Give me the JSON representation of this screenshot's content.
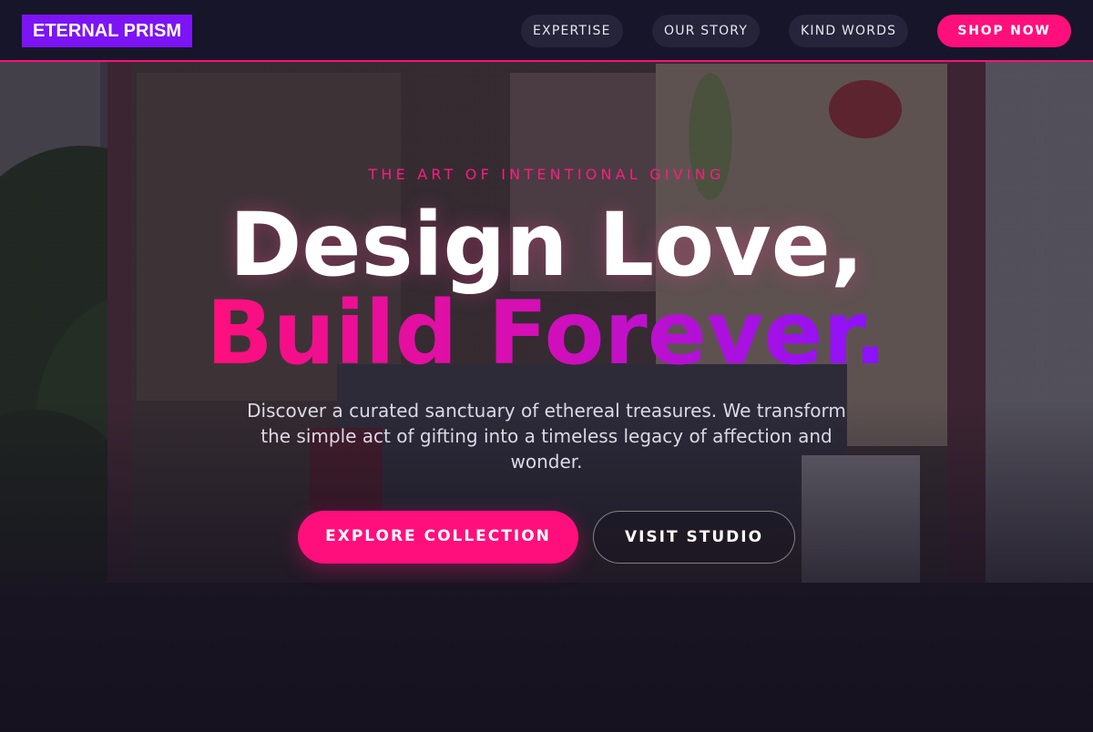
{
  "nav": {
    "logo": "ETERNAL PRISM",
    "links": [
      "EXPERTISE",
      "OUR STORY",
      "KIND WORDS"
    ],
    "cta": "SHOP NOW"
  },
  "hero": {
    "eyebrow": "THE ART OF INTENTIONAL GIVING",
    "headline_line1": "Design Love,",
    "headline_line2": "Build Forever.",
    "subtitle": "Discover a curated sanctuary of ethereal treasures. We transform the simple act of gifting into a timeless legacy of affection and wonder.",
    "primary_cta": "EXPLORE COLLECTION",
    "secondary_cta": "VISIT STUDIO",
    "background_image": "shop-window-photo"
  },
  "colors": {
    "accent": "#ff0f7b",
    "brand": "#7c14f5",
    "nav_bg": "#17152a",
    "hero_bg": "#15121f"
  }
}
